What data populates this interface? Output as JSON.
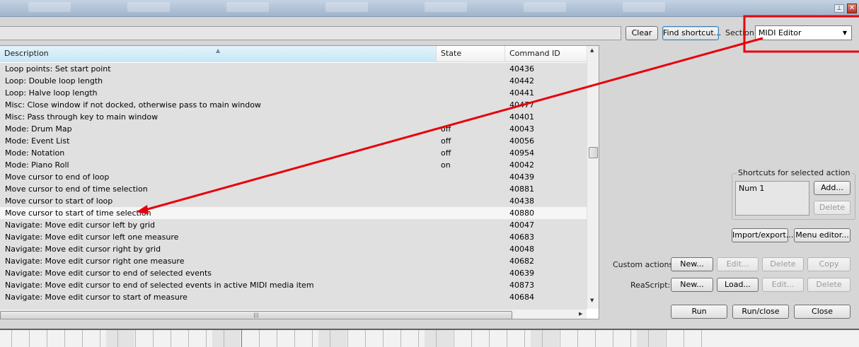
{
  "window": {
    "pin_glyph": "⊥",
    "close_glyph": "✕"
  },
  "toolbar": {
    "clear_label": "Clear",
    "find_shortcut_label": "Find shortcut...",
    "section_label": "Section:",
    "section_value": "MIDI Editor",
    "filter_value": ""
  },
  "list": {
    "headers": {
      "description": "Description",
      "state": "State",
      "command_id": "Command ID"
    },
    "rows": [
      {
        "desc": "Loop points: Set start point",
        "state": "",
        "cmd": "40436"
      },
      {
        "desc": "Loop: Double loop length",
        "state": "",
        "cmd": "40442"
      },
      {
        "desc": "Loop: Halve loop length",
        "state": "",
        "cmd": "40441"
      },
      {
        "desc": "Misc: Close window if not docked, otherwise pass to main window",
        "state": "",
        "cmd": "40477"
      },
      {
        "desc": "Misc: Pass through key to main window",
        "state": "",
        "cmd": "40401"
      },
      {
        "desc": "Mode: Drum Map",
        "state": "off",
        "cmd": "40043"
      },
      {
        "desc": "Mode: Event List",
        "state": "off",
        "cmd": "40056"
      },
      {
        "desc": "Mode: Notation",
        "state": "off",
        "cmd": "40954"
      },
      {
        "desc": "Mode: Piano Roll",
        "state": "on",
        "cmd": "40042"
      },
      {
        "desc": "Move cursor to end of loop",
        "state": "",
        "cmd": "40439"
      },
      {
        "desc": "Move cursor to end of time selection",
        "state": "",
        "cmd": "40881"
      },
      {
        "desc": "Move cursor to start of loop",
        "state": "",
        "cmd": "40438"
      },
      {
        "desc": "Move cursor to start of time selection",
        "state": "",
        "cmd": "40880"
      },
      {
        "desc": "Navigate: Move edit cursor left by grid",
        "state": "",
        "cmd": "40047"
      },
      {
        "desc": "Navigate: Move edit cursor left one measure",
        "state": "",
        "cmd": "40683"
      },
      {
        "desc": "Navigate: Move edit cursor right by grid",
        "state": "",
        "cmd": "40048"
      },
      {
        "desc": "Navigate: Move edit cursor right one measure",
        "state": "",
        "cmd": "40682"
      },
      {
        "desc": "Navigate: Move edit cursor to end of selected events",
        "state": "",
        "cmd": "40639"
      },
      {
        "desc": "Navigate: Move edit cursor to end of selected events in active MIDI media item",
        "state": "",
        "cmd": "40873"
      },
      {
        "desc": "Navigate: Move edit cursor to start of measure",
        "state": "",
        "cmd": "40684"
      }
    ],
    "selected_index": 12
  },
  "shortcuts": {
    "group_title": "Shortcuts for selected action",
    "items": [
      "Num 1"
    ],
    "add_label": "Add...",
    "delete_label": "Delete"
  },
  "actions": {
    "import_export_label": "Import/export...",
    "menu_editor_label": "Menu editor...",
    "custom_actions_label": "Custom actions:",
    "custom_new_label": "New...",
    "custom_edit_label": "Edit...",
    "custom_delete_label": "Delete",
    "custom_copy_label": "Copy",
    "reascript_label": "ReaScript:",
    "reascript_new_label": "New...",
    "reascript_load_label": "Load...",
    "reascript_edit_label": "Edit...",
    "reascript_delete_label": "Delete",
    "run_label": "Run",
    "run_close_label": "Run/close",
    "close_label": "Close"
  },
  "colors": {
    "annotation": "#e8000b",
    "selected_row": "#f6f6f6",
    "list_bg": "#e0e0e0"
  }
}
